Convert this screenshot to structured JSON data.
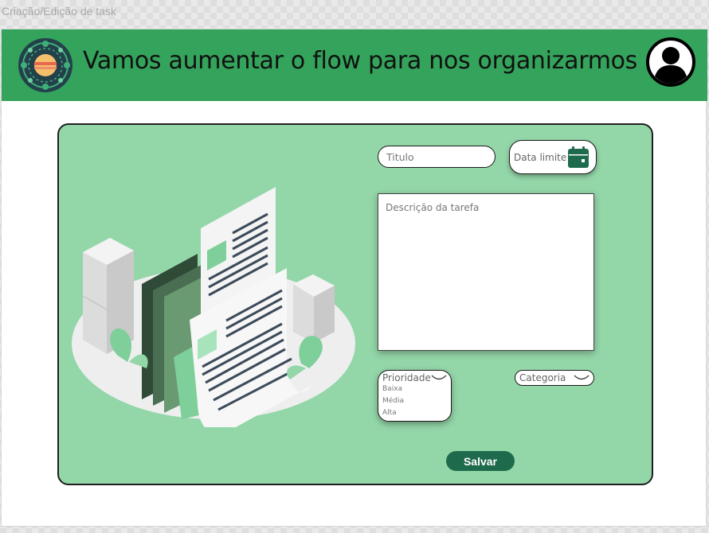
{
  "frame": {
    "label": "Criação/Edição de task"
  },
  "header": {
    "title": "Vamos aumentar o flow para nos organizarmos",
    "logo_icon": "mandala-logo-icon",
    "avatar_icon": "user-avatar-icon",
    "background": "#34a35b"
  },
  "form": {
    "title_placeholder": "Titulo",
    "deadline_label": "Data limite",
    "deadline_icon": "calendar-icon",
    "description_placeholder": "Descrição da tarefa",
    "priority": {
      "label": "Prioridade",
      "options": [
        "Baixa",
        "Média",
        "Alta"
      ]
    },
    "category": {
      "label": "Categoria"
    },
    "save_label": "Salvar"
  },
  "colors": {
    "card_bg": "#93d6a8",
    "save_button": "#1e6a4c",
    "calendar_icon": "#1e6a4c"
  }
}
